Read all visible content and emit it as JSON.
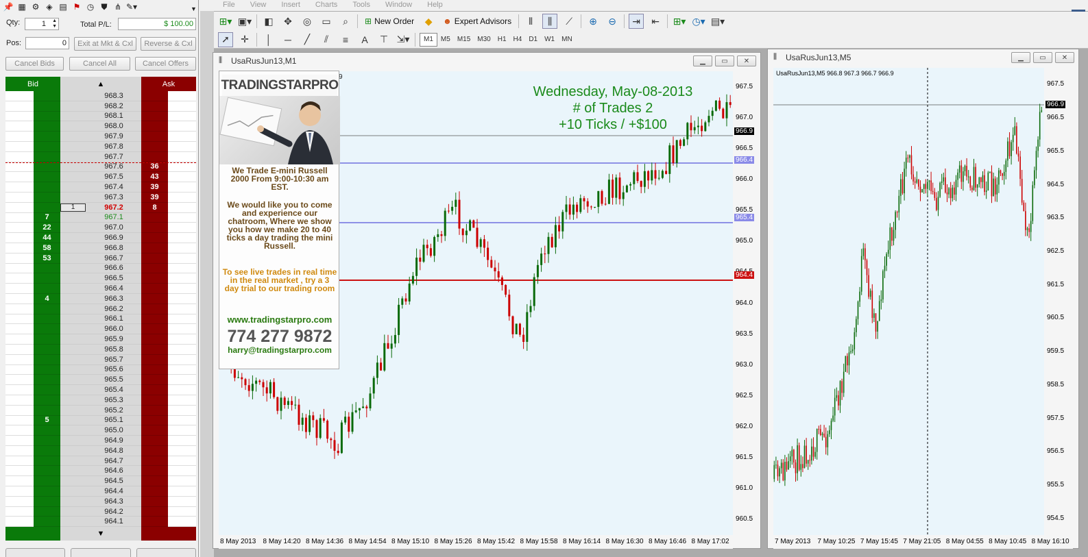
{
  "ladder": {
    "qty_label": "Qty:",
    "qty_value": "1",
    "total_pl_label": "Total P/L:",
    "total_pl_value": "$ 100.00",
    "pos_label": "Pos:",
    "pos_value": "0",
    "exit_btn": "Exit at Mkt & Cxl",
    "reverse_btn": "Reverse & Cxl",
    "cancel_bids": "Cancel Bids",
    "cancel_all": "Cancel All",
    "cancel_offers": "Cancel Offers",
    "hdr_bid": "Bid",
    "hdr_up": "▲",
    "hdr_ask": "Ask",
    "down_arrow": "▼",
    "position_marker": "1",
    "colors": {
      "bid": "#0a7a0a",
      "ask": "#8b0000",
      "last": "#d00000",
      "bidprice": "#1a8a1a"
    },
    "rows": [
      {
        "price": "968.3",
        "bid": "",
        "ask": ""
      },
      {
        "price": "968.2",
        "bid": "",
        "ask": ""
      },
      {
        "price": "968.1",
        "bid": "",
        "ask": ""
      },
      {
        "price": "968.0",
        "bid": "",
        "ask": ""
      },
      {
        "price": "967.9",
        "bid": "",
        "ask": ""
      },
      {
        "price": "967.8",
        "bid": "",
        "ask": ""
      },
      {
        "price": "967.7",
        "bid": "",
        "ask": ""
      },
      {
        "price": "967.6",
        "bid": "",
        "ask": "36"
      },
      {
        "price": "967.5",
        "bid": "",
        "ask": "43"
      },
      {
        "price": "967.4",
        "bid": "",
        "ask": "39"
      },
      {
        "price": "967.3",
        "bid": "",
        "ask": "39"
      },
      {
        "price": "967.2",
        "bid": "",
        "ask": "8"
      },
      {
        "price": "967.1",
        "bid": "7",
        "ask": ""
      },
      {
        "price": "967.0",
        "bid": "22",
        "ask": ""
      },
      {
        "price": "966.9",
        "bid": "44",
        "ask": ""
      },
      {
        "price": "966.8",
        "bid": "58",
        "ask": ""
      },
      {
        "price": "966.7",
        "bid": "53",
        "ask": ""
      },
      {
        "price": "966.6",
        "bid": "",
        "ask": ""
      },
      {
        "price": "966.5",
        "bid": "",
        "ask": ""
      },
      {
        "price": "966.4",
        "bid": "",
        "ask": ""
      },
      {
        "price": "966.3",
        "bid": "4",
        "ask": ""
      },
      {
        "price": "966.2",
        "bid": "",
        "ask": ""
      },
      {
        "price": "966.1",
        "bid": "",
        "ask": ""
      },
      {
        "price": "966.0",
        "bid": "",
        "ask": ""
      },
      {
        "price": "965.9",
        "bid": "",
        "ask": ""
      },
      {
        "price": "965.8",
        "bid": "",
        "ask": ""
      },
      {
        "price": "965.7",
        "bid": "",
        "ask": ""
      },
      {
        "price": "965.6",
        "bid": "",
        "ask": ""
      },
      {
        "price": "965.5",
        "bid": "",
        "ask": ""
      },
      {
        "price": "965.4",
        "bid": "",
        "ask": ""
      },
      {
        "price": "965.3",
        "bid": "",
        "ask": ""
      },
      {
        "price": "965.2",
        "bid": "",
        "ask": ""
      },
      {
        "price": "965.1",
        "bid": "5",
        "ask": ""
      },
      {
        "price": "965.0",
        "bid": "",
        "ask": ""
      },
      {
        "price": "964.9",
        "bid": "",
        "ask": ""
      },
      {
        "price": "964.8",
        "bid": "",
        "ask": ""
      },
      {
        "price": "964.7",
        "bid": "",
        "ask": ""
      },
      {
        "price": "964.6",
        "bid": "",
        "ask": ""
      },
      {
        "price": "964.5",
        "bid": "",
        "ask": ""
      },
      {
        "price": "964.4",
        "bid": "",
        "ask": ""
      },
      {
        "price": "964.3",
        "bid": "",
        "ask": ""
      },
      {
        "price": "964.2",
        "bid": "",
        "ask": ""
      },
      {
        "price": "964.1",
        "bid": "",
        "ask": ""
      }
    ]
  },
  "menu": [
    "File",
    "View",
    "Insert",
    "Charts",
    "Tools",
    "Window",
    "Help"
  ],
  "toolbar": {
    "new_order": "New Order",
    "expert_advisors": "Expert Advisors"
  },
  "timeframes": [
    "M1",
    "M5",
    "M15",
    "M30",
    "H1",
    "H4",
    "D1",
    "W1",
    "MN"
  ],
  "active_timeframe": "M1",
  "chart1": {
    "title": "UsaRusJun13,M1",
    "headline": "Wednesday, May-08-2013",
    "trades": "# of Trades 2",
    "result": "+10 Ticks / +$100",
    "partial_label": "9",
    "price_labels": [
      "967.5",
      "967.0",
      "966.5",
      "966.0",
      "965.5",
      "965.0",
      "964.5",
      "964.0",
      "963.5",
      "963.0",
      "962.5",
      "962.0",
      "961.5",
      "961.0",
      "960.5"
    ],
    "tags": {
      "bid": "966.9",
      "upper": "966.4",
      "mid": "965.4",
      "red": "964.4"
    },
    "time_labels": [
      "8 May 2013",
      "8 May 14:20",
      "8 May 14:36",
      "8 May 14:54",
      "8 May 15:10",
      "8 May 15:26",
      "8 May 15:42",
      "8 May 15:58",
      "8 May 16:14",
      "8 May 16:30",
      "8 May 16:46",
      "8 May 17:02"
    ],
    "colors": {
      "headline": "#1a8a1a",
      "bull": "#0a6a0a",
      "bear": "#cc0000",
      "hline_blue": "#7070e0",
      "hline_red": "#cc1111"
    }
  },
  "chart2": {
    "title": "UsaRusJun13,M5",
    "info": "UsaRusJun13,M5  966.8 967.3 966.7 966.9",
    "price_labels": [
      "967.5",
      "966.5",
      "965.5",
      "964.5",
      "963.5",
      "962.5",
      "961.5",
      "960.5",
      "959.5",
      "958.5",
      "957.5",
      "956.5",
      "955.5",
      "954.5"
    ],
    "current_tag": "966.9",
    "time_labels": [
      "7 May 2013",
      "7 May 10:25",
      "7 May 15:45",
      "7 May 21:05",
      "8 May 04:55",
      "8 May 10:45",
      "8 May 16:10"
    ]
  },
  "ad": {
    "brand": "TRADINGSTARPRO",
    "line1": "We Trade E-mini Russell 2000 From 9:00-10:30 am EST.",
    "line2": "We would like you to come and experience our chatroom, Where we show you how we make 20 to 40 ticks a day trading the mini Russell.",
    "line3": "To see live trades in real time in the real market , try a 3 day trial to our trading room",
    "website": "www.tradingstarpro.com",
    "phone": "774 277 9872",
    "email": "harry@tradingstarpro.com",
    "colors": {
      "brown": "#6b4a1a",
      "orange": "#d08a10",
      "green": "#2a7a10"
    }
  }
}
